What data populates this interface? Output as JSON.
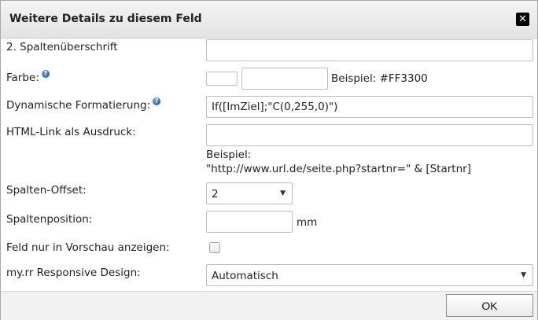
{
  "dialog": {
    "title": "Weitere Details zu diesem Feld",
    "close_icon": "close-icon",
    "ok_label": "OK"
  },
  "fields": {
    "column_header": {
      "label": "2. Spaltenüberschrift",
      "value": ""
    },
    "color": {
      "label": "Farbe:",
      "help_icon": "?",
      "value": "",
      "example": "Beispiel: #FF3300"
    },
    "dynamic_format": {
      "label": "Dynamische Formatierung:",
      "help_icon": "?",
      "value": "If([ImZiel];\"C(0,255,0)\")"
    },
    "html_link": {
      "label": "HTML-Link als Ausdruck:",
      "value": "",
      "example_line1": "Beispiel:",
      "example_line2": "\"http://www.url.de/seite.php?startnr=\" & [Startnr]"
    },
    "column_offset": {
      "label": "Spalten-Offset:",
      "selected": "2"
    },
    "column_position": {
      "label": "Spaltenposition:",
      "value": "",
      "unit": "mm"
    },
    "preview_only": {
      "label": "Feld nur in Vorschau anzeigen:",
      "checked": false
    },
    "responsive": {
      "label": "my.rr Responsive Design:",
      "selected": "Automatisch"
    }
  },
  "icons": {
    "dropdown_arrow": "▼"
  }
}
